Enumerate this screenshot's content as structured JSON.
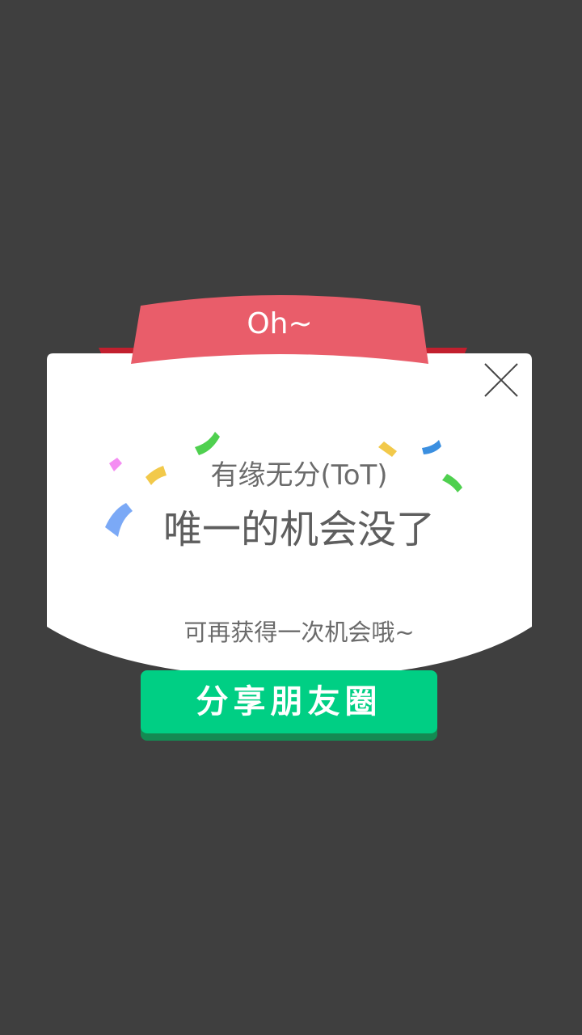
{
  "dialog": {
    "ribbon_label": "Oh~",
    "subtitle": "有缘无分(ToT)",
    "title": "唯一的机会没了",
    "hint": "可再获得一次机会哦~",
    "share_button_label": "分享朋友圈",
    "close_icon": "close-icon"
  },
  "colors": {
    "background": "#3f3f3f",
    "card": "#ffffff",
    "ribbon": "#e95d6a",
    "ribbon_tail": "#c21f2e",
    "ribbon_fold": "#8f1420",
    "button": "#00cf84",
    "button_shadow": "#148a52",
    "text": "#666666"
  }
}
